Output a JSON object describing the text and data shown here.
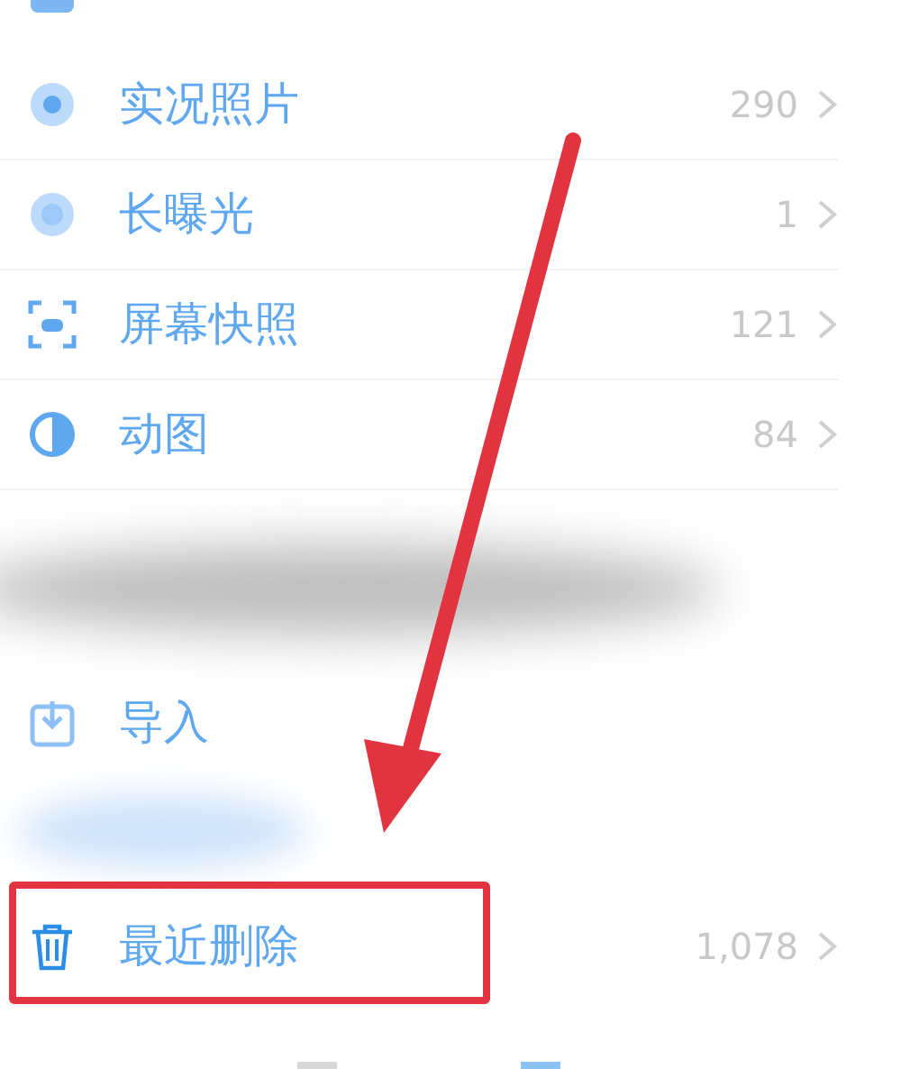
{
  "media_types": [
    {
      "label": "实况照片",
      "count": "290",
      "kind": "live"
    },
    {
      "label": "长曝光",
      "count": "1",
      "kind": "exposure"
    },
    {
      "label": "屏幕快照",
      "count": "121",
      "kind": "screenshot"
    },
    {
      "label": "动图",
      "count": "84",
      "kind": "animated"
    }
  ],
  "utilities": [
    {
      "label": "导入",
      "kind": "import",
      "highlighted": false
    },
    {
      "label": "最近删除",
      "count": "1,078",
      "kind": "trash",
      "highlighted": true
    }
  ]
}
